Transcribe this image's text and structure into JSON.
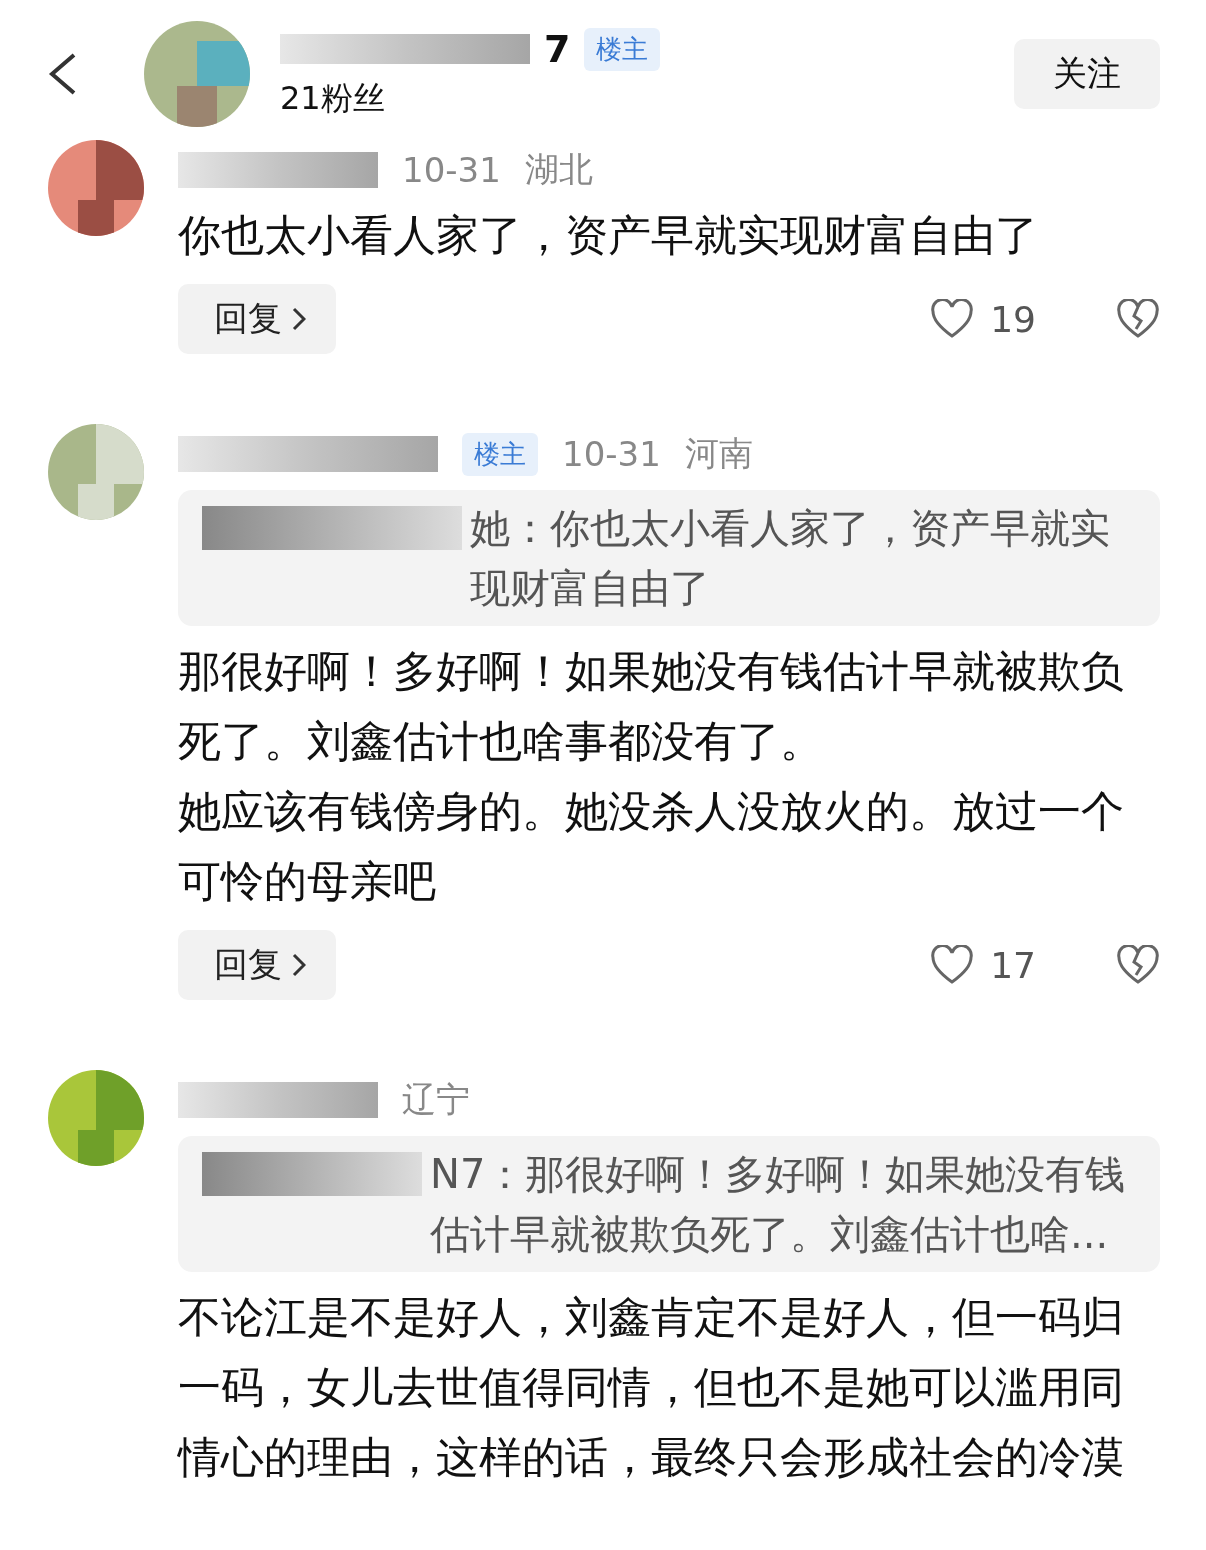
{
  "header": {
    "name": "7",
    "badge": "楼主",
    "followers": "21粉丝",
    "follow_button": "关注"
  },
  "comments": [
    {
      "date": "10-31",
      "region": "湖北",
      "paragraphs": [
        "你也太小看人家了，资产早就实现财富自由了"
      ],
      "reply": "回复",
      "likes": "19"
    },
    {
      "badge": "楼主",
      "date": "10-31",
      "region": "河南",
      "quote": "她：你也太小看人家了，资产早就实现财富自由了",
      "paragraphs": [
        "那很好啊！多好啊！如果她没有钱估计早就被欺负死了。刘鑫估计也啥事都没有了。",
        "她应该有钱傍身的。她没杀人没放火的。放过一个可怜的母亲吧"
      ],
      "reply": "回复",
      "likes": "17"
    },
    {
      "region": "辽宁",
      "quote": "N7：那很好啊！多好啊！如果她没有钱估计早就被欺负死了。刘鑫估计也啥...",
      "paragraphs": [
        "不论江是不是好人，刘鑫肯定不是好人，但一码归一码，女儿去世值得同情，但也不是她可以滥用同情心的理由，这样的话，最终只会形成社会的冷漠"
      ]
    }
  ]
}
